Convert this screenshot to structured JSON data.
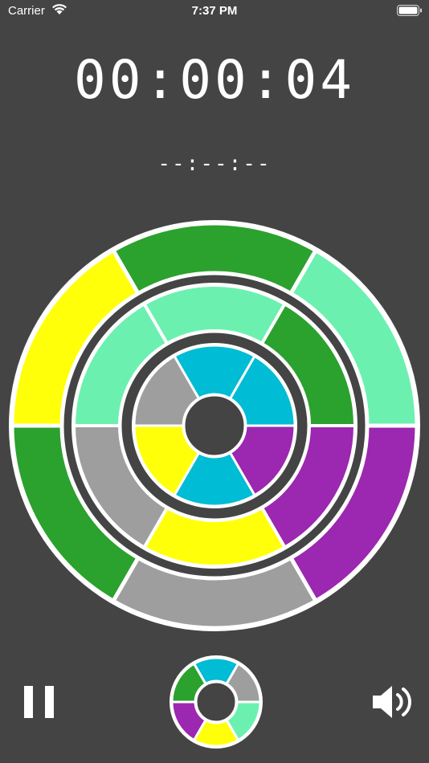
{
  "status_bar": {
    "carrier": "Carrier",
    "time": "7:37 PM",
    "icons": [
      "wifi-icon",
      "battery-icon"
    ]
  },
  "timer": {
    "elapsed": "00:00:04",
    "best": "--:--:--"
  },
  "colors": {
    "background": "#444444",
    "green": "#2ba12e",
    "mint": "#6cf0b0",
    "yellow": "#ffff0a",
    "gray": "#9e9e9e",
    "purple": "#9c27b0",
    "cyan": "#00bcd4"
  },
  "board": {
    "rings": [
      {
        "name": "outer",
        "start_angle": -120,
        "segments": [
          "green",
          "mint",
          "purple",
          "gray",
          "green",
          "yellow"
        ]
      },
      {
        "name": "middle",
        "start_angle": -120,
        "segments": [
          "mint",
          "green",
          "purple",
          "yellow",
          "gray",
          "mint"
        ]
      },
      {
        "name": "inner",
        "start_angle": -120,
        "segments": [
          "cyan",
          "cyan",
          "purple",
          "cyan",
          "yellow",
          "gray"
        ]
      }
    ]
  },
  "next_piece": {
    "segments": [
      "cyan",
      "gray",
      "mint",
      "yellow",
      "purple",
      "green"
    ]
  },
  "controls": {
    "pause_icon": "pause-icon",
    "sound_icon": "speaker-icon"
  }
}
